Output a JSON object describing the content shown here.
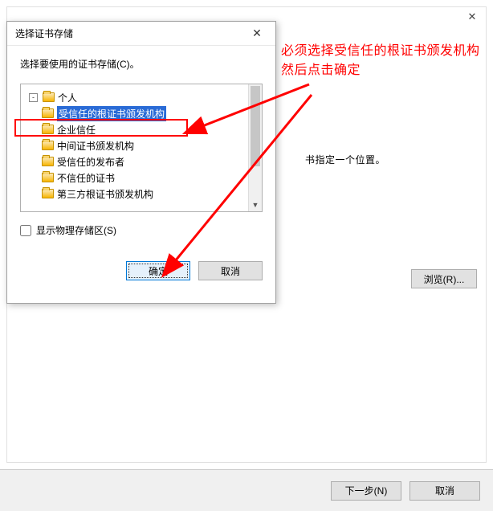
{
  "wizard": {
    "hint_text": "书指定一个位置。",
    "browse_label": "浏览(R)...",
    "next_label": "下一步(N)",
    "cancel_label": "取消"
  },
  "dialog": {
    "title": "选择证书存储",
    "caption": "选择要使用的证书存储(C)。",
    "toggle_glyph": "-",
    "tree": [
      {
        "label": "个人"
      },
      {
        "label": "受信任的根证书颁发机构",
        "selected": true
      },
      {
        "label": "企业信任"
      },
      {
        "label": "中间证书颁发机构"
      },
      {
        "label": "受信任的发布者"
      },
      {
        "label": "不信任的证书"
      },
      {
        "label": "第三方根证书颁发机构"
      }
    ],
    "show_physical_label": "显示物理存储区(S)",
    "ok_label": "确定",
    "cancel_label": "取消"
  },
  "annotation": {
    "line1": "必须选择受信任的根证书颁发机构",
    "line2": "然后点击确定"
  }
}
